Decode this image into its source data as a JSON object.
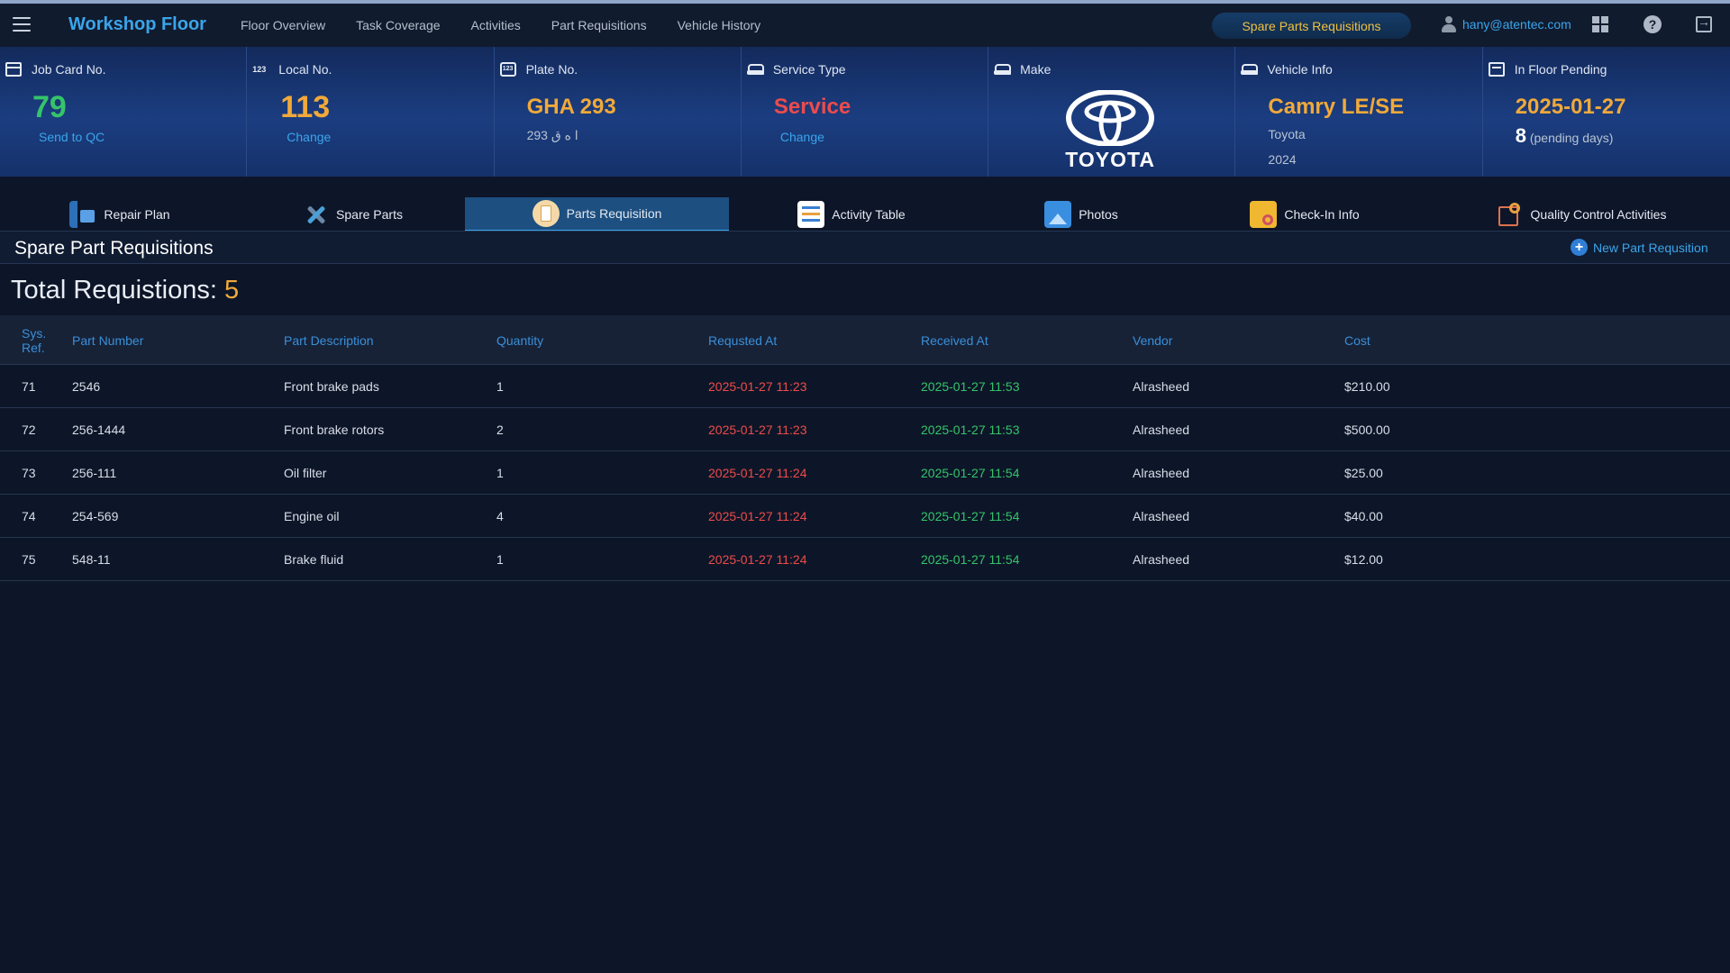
{
  "nav": {
    "brand": "Workshop Floor",
    "links": [
      "Floor Overview",
      "Task Coverage",
      "Activities",
      "Part Requisitions",
      "Vehicle History"
    ],
    "pill": "Spare Parts Requisitions",
    "user_email": "hany@atentec.com"
  },
  "cards": {
    "job": {
      "label": "Job Card No.",
      "value": "79",
      "action": "Send to QC"
    },
    "local": {
      "label": "Local No.",
      "value": "113",
      "action": "Change"
    },
    "plate": {
      "label": "Plate No.",
      "value": "GHA 293",
      "sub": "293 ا ه ق"
    },
    "service": {
      "label": "Service Type",
      "value": "Service",
      "action": "Change"
    },
    "make": {
      "label": "Make",
      "logo_text": "TOYOTA"
    },
    "vehicle": {
      "label": "Vehicle Info",
      "value": "Camry LE/SE",
      "brand": "Toyota",
      "year": "2024"
    },
    "pending": {
      "label": "In Floor Pending",
      "value": "2025-01-27",
      "days": "8",
      "days_suffix": "(pending days)"
    }
  },
  "tabs": [
    {
      "label": "Repair Plan"
    },
    {
      "label": "Spare Parts"
    },
    {
      "label": "Parts Requisition"
    },
    {
      "label": "Activity Table"
    },
    {
      "label": "Photos"
    },
    {
      "label": "Check-In Info"
    },
    {
      "label": "Quality Control Activities"
    }
  ],
  "section": {
    "title": "Spare Part Requisitions",
    "new_button": "New Part Requsition",
    "total_label": "Total Requistions:",
    "total_count": "5"
  },
  "table": {
    "headers": [
      "Sys.\nRef.",
      "Part Number",
      "Part Description",
      "Quantity",
      "Requsted At",
      "Received At",
      "Vendor",
      "Cost"
    ],
    "rows": [
      {
        "ref": "71",
        "part_number": "2546",
        "description": "Front brake pads",
        "qty": "1",
        "requested": "2025-01-27 11:23",
        "received": "2025-01-27 11:53",
        "vendor": "Alrasheed",
        "cost": "$210.00"
      },
      {
        "ref": "72",
        "part_number": "256-1444",
        "description": "Front brake rotors",
        "qty": "2",
        "requested": "2025-01-27 11:23",
        "received": "2025-01-27 11:53",
        "vendor": "Alrasheed",
        "cost": "$500.00"
      },
      {
        "ref": "73",
        "part_number": "256-111",
        "description": "Oil filter",
        "qty": "1",
        "requested": "2025-01-27 11:24",
        "received": "2025-01-27 11:54",
        "vendor": "Alrasheed",
        "cost": "$25.00"
      },
      {
        "ref": "74",
        "part_number": "254-569",
        "description": "Engine oil",
        "qty": "4",
        "requested": "2025-01-27 11:24",
        "received": "2025-01-27 11:54",
        "vendor": "Alrasheed",
        "cost": "$40.00"
      },
      {
        "ref": "75",
        "part_number": "548-11",
        "description": "Brake fluid",
        "qty": "1",
        "requested": "2025-01-27 11:24",
        "received": "2025-01-27 11:54",
        "vendor": "Alrasheed",
        "cost": "$12.00"
      }
    ]
  },
  "colors": {
    "accent": "#3aa5ea",
    "green": "#35c46a",
    "orange": "#f0a93a",
    "red": "#ee4b4b"
  }
}
